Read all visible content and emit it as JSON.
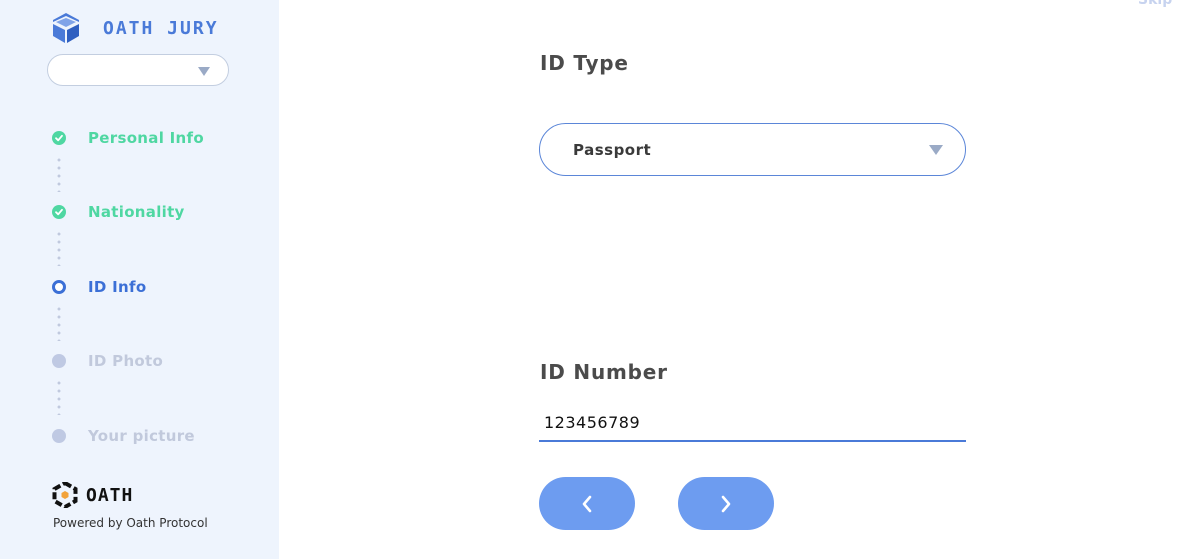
{
  "brand": {
    "name": "OATH JURY",
    "logo_icon": "cube-logo-icon",
    "accent_color": "#4a7ad8"
  },
  "language_select": {
    "value": ""
  },
  "steps": [
    {
      "label": "Personal Info",
      "status": "done"
    },
    {
      "label": "Nationality",
      "status": "done"
    },
    {
      "label": "ID Info",
      "status": "current"
    },
    {
      "label": "ID Photo",
      "status": "todo"
    },
    {
      "label": "Your picture",
      "status": "todo"
    }
  ],
  "status_colors": {
    "done": "#4fd7a2",
    "current": "#3b6fd6",
    "todo": "#bfc9e3"
  },
  "footer": {
    "logo_text": "OATH",
    "logo_icon": "oath-hexagon-logo-icon",
    "powered_by": "Powered by Oath Protocol"
  },
  "header": {
    "skip_label": "Skip"
  },
  "form": {
    "id_type": {
      "label": "ID Type",
      "value": "Passport",
      "caret_icon": "caret-down-icon"
    },
    "id_number": {
      "label": "ID Number",
      "value": "123456789"
    }
  },
  "navigation": {
    "back_icon": "chevron-left-icon",
    "next_icon": "chevron-right-icon",
    "button_color": "#6d9cf0"
  }
}
